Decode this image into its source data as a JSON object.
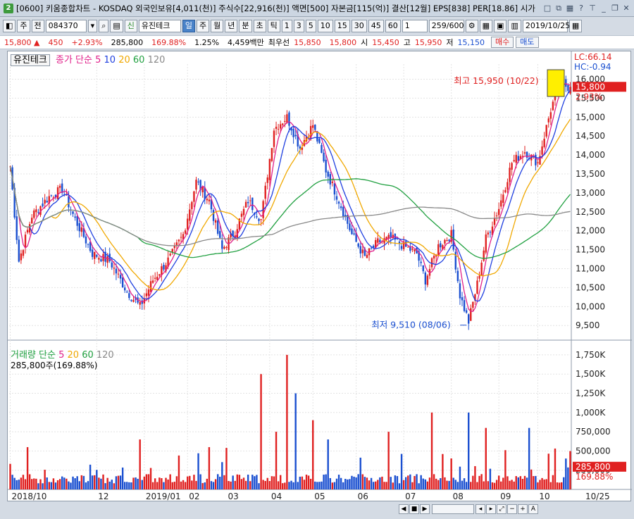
{
  "window": {
    "badge": "2",
    "title": "[0600] 키움종합차트 - KOSDAQ 외국인보유[4,011(천)] 주식수[22,916(천)] 액면[500] 자본금[115(억)] 결산[12월] EPS[838] PER[18.86] 시가"
  },
  "toolbar": {
    "mode": "주",
    "prefix": "전",
    "code": "084370",
    "stock_badge": "신",
    "stock_name": "유진테크",
    "periods": [
      "일",
      "주",
      "월",
      "년",
      "분",
      "초",
      "틱"
    ],
    "selected_period": "일",
    "intervals": [
      "1",
      "3",
      "5",
      "10",
      "15",
      "30",
      "45",
      "60"
    ],
    "interval_value": "1",
    "count": "259/600",
    "date": "2019/10/25"
  },
  "quote": {
    "price": "15,800",
    "change": "450",
    "change_pct": "+2.93%",
    "volume": "285,800",
    "volume_ratio": "169.88%",
    "turnover": "1.25%",
    "amount": "4,459백만",
    "best_ask_label": "최우선",
    "best_ask": "15,850",
    "best_bid": "15,800",
    "open_label": "시",
    "open": "15,450",
    "high_label": "고",
    "high": "15,950",
    "low_label": "저",
    "low": "15,150",
    "buy_label": "매수",
    "sell_label": "매도"
  },
  "price_panel": {
    "stock_label": "유진테크",
    "legend_title": "종가 단순",
    "ma_periods": [
      "5",
      "10",
      "20",
      "60",
      "120"
    ],
    "ma_colors": [
      "#e0208a",
      "#2040e0",
      "#f0a800",
      "#20a040",
      "#888888"
    ],
    "lc": "LC:66.14",
    "hc": "HC:-0.94",
    "high_annotation": "최고 15,950 (10/22)",
    "low_annotation": "최저 9,510 (08/06)",
    "last_price_tag": "15,800",
    "last_pct_tag": "2.93%",
    "y_ticks": [
      "16,000",
      "15,500",
      "15,000",
      "14,500",
      "14,000",
      "13,500",
      "13,000",
      "12,500",
      "12,000",
      "11,500",
      "11,000",
      "10,500",
      "10,000",
      "9,500"
    ]
  },
  "volume_panel": {
    "legend_title": "거래량 단순",
    "ma_periods": [
      "5",
      "20",
      "60",
      "120"
    ],
    "value_label": "285,800주(169.88%)",
    "last_volume_tag": "285,800",
    "last_pct_tag": "169.88%",
    "y_ticks": [
      "1,750K",
      "1,500K",
      "1,250K",
      "1,000K",
      "750,000",
      "500,000",
      "250,000"
    ]
  },
  "x_axis": {
    "labels": [
      "2018/10",
      "12",
      "2019/01",
      "02",
      "03",
      "04",
      "05",
      "06",
      "07",
      "08",
      "09",
      "10"
    ],
    "end_label": "10/25"
  },
  "colors": {
    "up": "#e02020",
    "down": "#1a4fd0",
    "grid": "#e4e4e4"
  },
  "chart_data": {
    "type": "candlestick",
    "title": "유진테크",
    "ylim": [
      9300,
      16400
    ],
    "high": {
      "value": 15950,
      "date": "10/22"
    },
    "low": {
      "value": 9510,
      "date": "08/06"
    },
    "last": 15800,
    "months": [
      "2018/10",
      "12",
      "2019/01",
      "02",
      "03",
      "04",
      "05",
      "06",
      "07",
      "08",
      "09",
      "10"
    ],
    "close_path": [
      {
        "x": 0,
        "y": 13700
      },
      {
        "x": 4,
        "y": 11200
      },
      {
        "x": 10,
        "y": 12400
      },
      {
        "x": 18,
        "y": 12900
      },
      {
        "x": 24,
        "y": 13100
      },
      {
        "x": 30,
        "y": 12300
      },
      {
        "x": 38,
        "y": 11400
      },
      {
        "x": 46,
        "y": 11200
      },
      {
        "x": 54,
        "y": 10400
      },
      {
        "x": 60,
        "y": 10000
      },
      {
        "x": 66,
        "y": 10700
      },
      {
        "x": 74,
        "y": 11300
      },
      {
        "x": 80,
        "y": 11900
      },
      {
        "x": 86,
        "y": 13300
      },
      {
        "x": 92,
        "y": 12800
      },
      {
        "x": 98,
        "y": 11500
      },
      {
        "x": 104,
        "y": 12000
      },
      {
        "x": 110,
        "y": 12800
      },
      {
        "x": 116,
        "y": 12300
      },
      {
        "x": 122,
        "y": 14700
      },
      {
        "x": 128,
        "y": 15000
      },
      {
        "x": 134,
        "y": 14200
      },
      {
        "x": 140,
        "y": 14800
      },
      {
        "x": 146,
        "y": 13600
      },
      {
        "x": 152,
        "y": 12800
      },
      {
        "x": 158,
        "y": 11900
      },
      {
        "x": 164,
        "y": 11300
      },
      {
        "x": 170,
        "y": 11700
      },
      {
        "x": 176,
        "y": 11800
      },
      {
        "x": 182,
        "y": 11600
      },
      {
        "x": 188,
        "y": 11400
      },
      {
        "x": 192,
        "y": 10700
      },
      {
        "x": 198,
        "y": 11600
      },
      {
        "x": 204,
        "y": 11900
      },
      {
        "x": 208,
        "y": 10300
      },
      {
        "x": 212,
        "y": 9600
      },
      {
        "x": 216,
        "y": 10600
      },
      {
        "x": 220,
        "y": 11800
      },
      {
        "x": 226,
        "y": 12600
      },
      {
        "x": 232,
        "y": 13800
      },
      {
        "x": 238,
        "y": 14100
      },
      {
        "x": 244,
        "y": 13800
      },
      {
        "x": 250,
        "y": 15200
      },
      {
        "x": 254,
        "y": 15900
      },
      {
        "x": 258,
        "y": 15800
      }
    ],
    "volume_spikes": [
      {
        "x": 8,
        "v": 550000
      },
      {
        "x": 60,
        "v": 650000
      },
      {
        "x": 92,
        "v": 550000
      },
      {
        "x": 116,
        "y_note": "",
        "v": 1500000
      },
      {
        "x": 123,
        "v": 750000
      },
      {
        "x": 128,
        "v": 1750000
      },
      {
        "x": 132,
        "v": 1250000
      },
      {
        "x": 140,
        "v": 900000
      },
      {
        "x": 147,
        "v": 650000
      },
      {
        "x": 175,
        "v": 750000
      },
      {
        "x": 195,
        "v": 1000000
      },
      {
        "x": 212,
        "v": 1000000
      },
      {
        "x": 220,
        "v": 800000
      },
      {
        "x": 240,
        "v": 800000
      },
      {
        "x": 258,
        "v": 285800
      }
    ]
  }
}
